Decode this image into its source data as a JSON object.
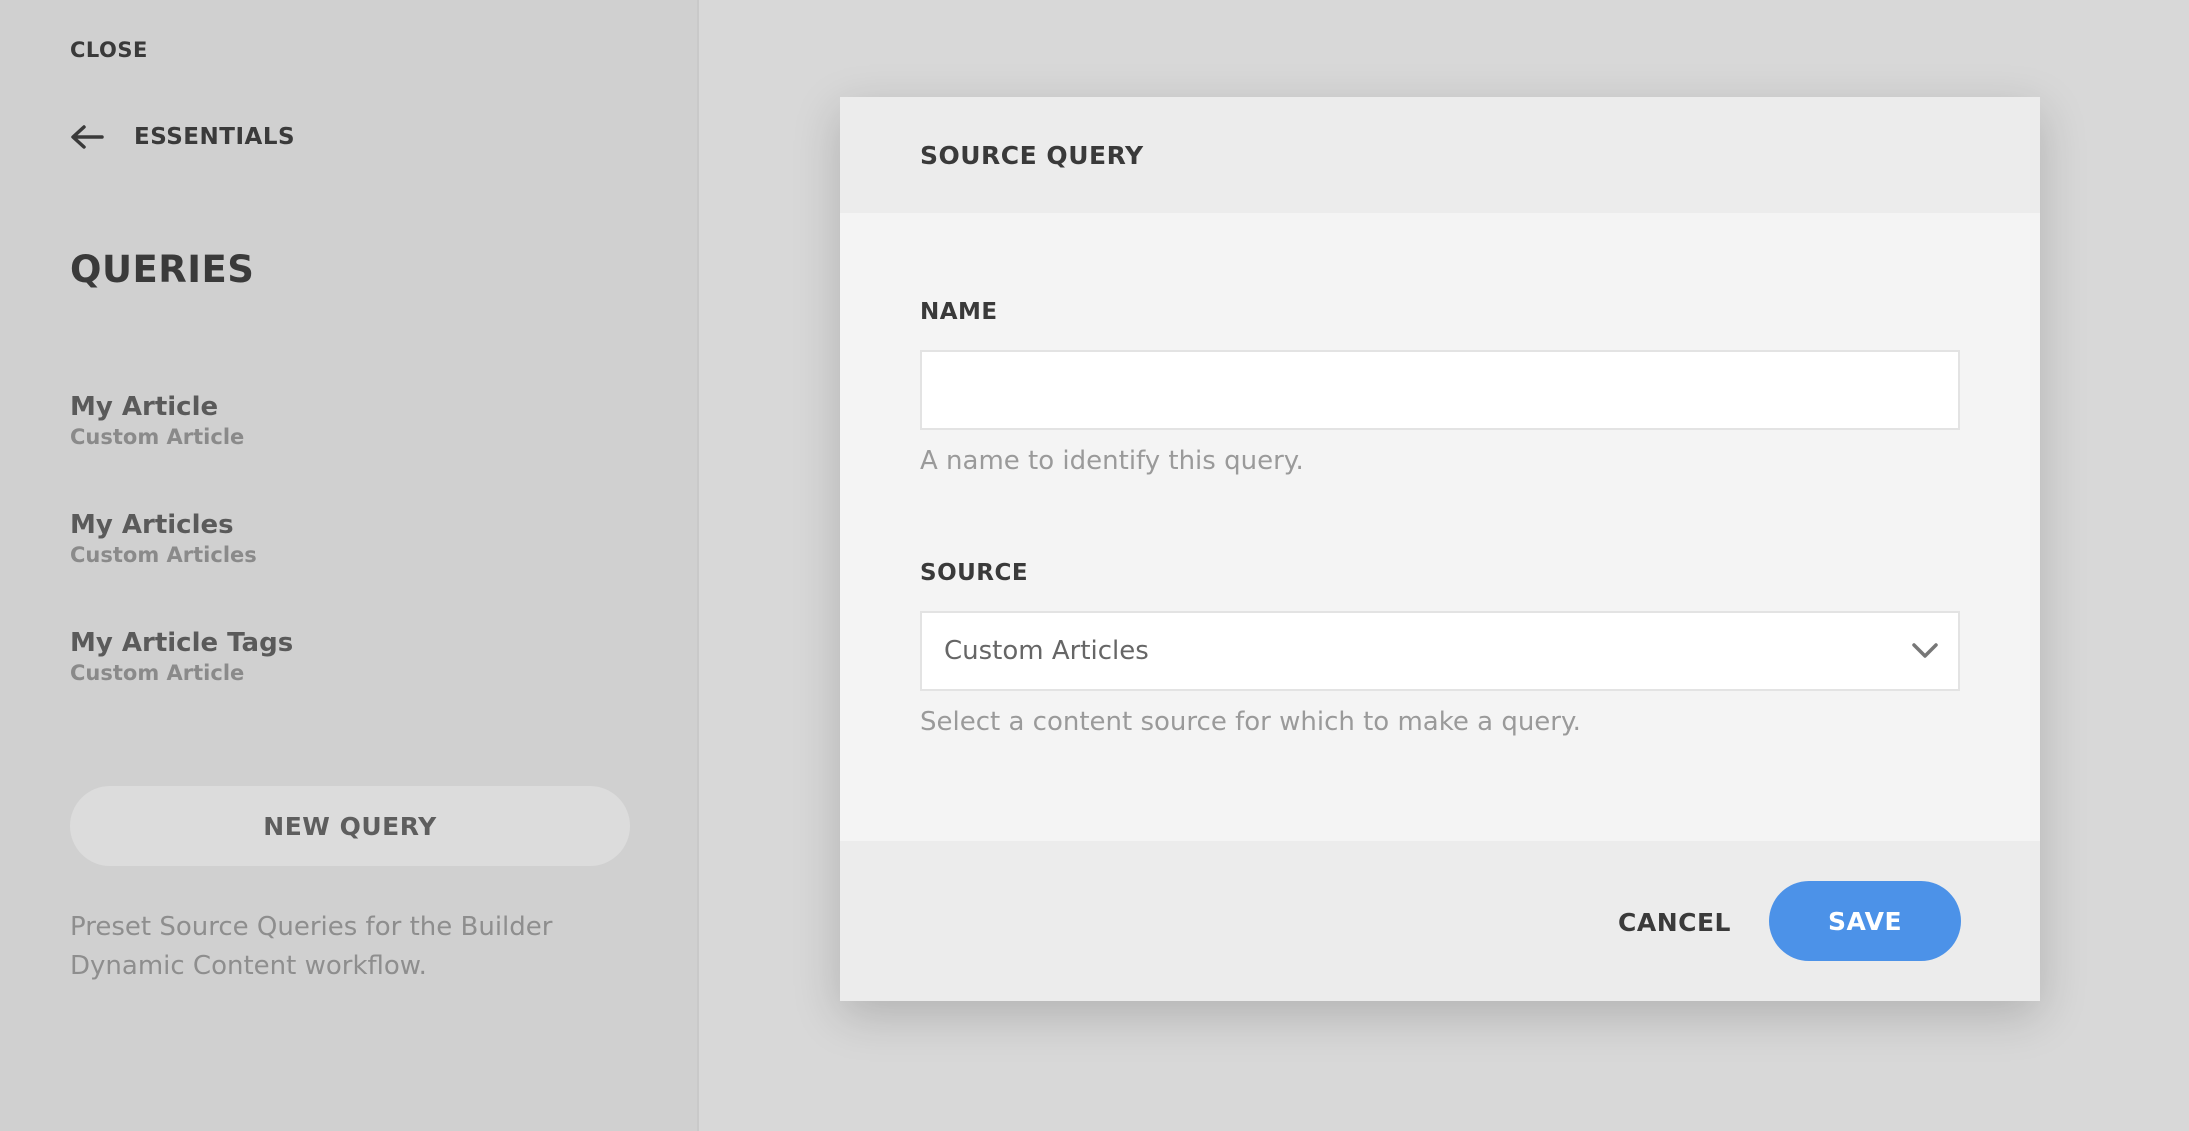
{
  "sidebar": {
    "close_label": "CLOSE",
    "back_label": "ESSENTIALS",
    "title": "QUERIES",
    "queries": [
      {
        "name": "My Article",
        "source": "Custom Article"
      },
      {
        "name": "My Articles",
        "source": "Custom Articles"
      },
      {
        "name": "My Article Tags",
        "source": "Custom Article"
      }
    ],
    "new_query_label": "NEW QUERY",
    "description": "Preset Source Queries for the Builder Dynamic Content workflow."
  },
  "modal": {
    "title": "SOURCE QUERY",
    "name_field": {
      "label": "NAME",
      "value": "",
      "help": "A name to identify this query."
    },
    "source_field": {
      "label": "SOURCE",
      "selected": "Custom Articles",
      "help": "Select a content source for which to make a query."
    },
    "cancel_label": "CANCEL",
    "save_label": "SAVE"
  },
  "colors": {
    "accent": "#4c92e8",
    "sidebar_bg": "#d0d0d0",
    "page_bg": "#d8d8d8"
  },
  "icons": {
    "back": "arrow-left-icon",
    "select": "chevron-down-icon"
  }
}
